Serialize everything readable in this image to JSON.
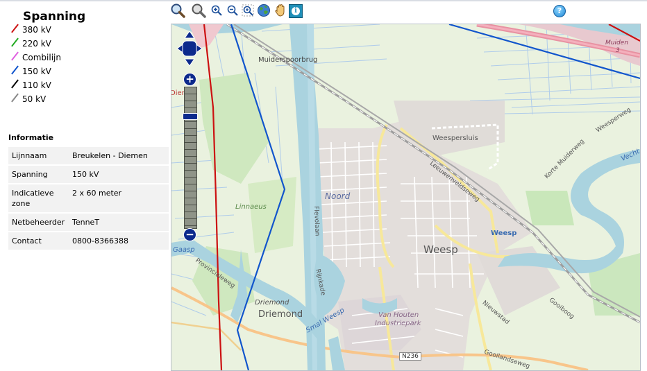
{
  "legend": {
    "title": "Spanning",
    "items": [
      {
        "label": "380 kV",
        "color": "#cc1111"
      },
      {
        "label": "220 kV",
        "color": "#22aa22"
      },
      {
        "label": "Combilijn",
        "color": "#e060e0"
      },
      {
        "label": "150 kV",
        "color": "#1155cc"
      },
      {
        "label": "110 kV",
        "color": "#000000"
      },
      {
        "label": "50 kV",
        "color": "#888888"
      }
    ]
  },
  "info": {
    "title": "Informatie",
    "rows": [
      {
        "key": "Lijnnaam",
        "value": "Breukelen - Diemen"
      },
      {
        "key": "Spanning",
        "value": "150 kV"
      },
      {
        "key": "Indicatieve zone",
        "value": "2 x 60 meter"
      },
      {
        "key": "Netbeheerder",
        "value": "TenneT"
      },
      {
        "key": "Contact",
        "value": "0800-8366388"
      }
    ]
  },
  "toolbar": {
    "tools": [
      {
        "name": "zoom-in-box-tool",
        "icon": "magnifier-plus-icon"
      },
      {
        "name": "zoom-out-box-tool",
        "icon": "magnifier-minus-icon"
      },
      {
        "name": "zoom-in-tool",
        "icon": "zoom-in-icon"
      },
      {
        "name": "zoom-out-tool",
        "icon": "zoom-out-icon"
      },
      {
        "name": "zoom-extent-tool",
        "icon": "zoom-extent-icon"
      },
      {
        "name": "full-extent-tool",
        "icon": "globe-icon"
      },
      {
        "name": "pan-tool",
        "icon": "hand-icon"
      },
      {
        "name": "identify-tool",
        "icon": "info-icon"
      }
    ],
    "help_label": "?"
  },
  "map": {
    "labels": {
      "muiderspoorbrug": "Muiderspoorbrug",
      "muiden": "Muiden",
      "muiden_3": "3",
      "diemen": "Diemen",
      "weespersluis": "Weespersluis",
      "leeuwenveldseweg": "Leeuwenveldseweg",
      "korte_muiderweg": "Korte Muiderweg",
      "weesperweg": "Weesperweg",
      "vecht": "Vecht",
      "linnaeus": "Linnaeus",
      "noord": "Noord",
      "flevolaan": "Flevolaan",
      "weesp": "Weesp",
      "weesp_station": "Weesp",
      "rijnkade": "Rijnkade",
      "provincialeweg": "Provincialeweg",
      "gaasp": "Gaasp",
      "driemond_small": "Driemond",
      "driemond": "Driemond",
      "smal_weesp": "Smal Weesp",
      "van_houten": "Van Houten",
      "industriepark": "Industriepark",
      "nieuwstad": "Nieuwstad",
      "gooiboog": "Gooiboog",
      "n236": "N236",
      "gooilandseweg": "Gooilandseweg"
    }
  }
}
